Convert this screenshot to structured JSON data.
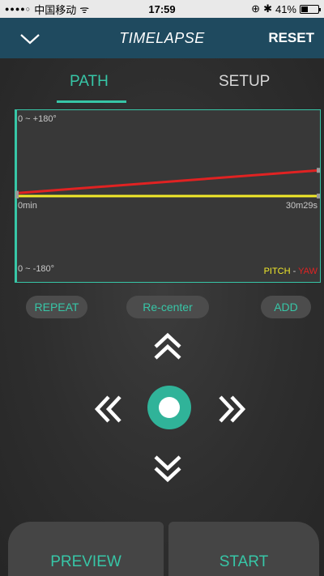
{
  "status_bar": {
    "signal": "●●●●○",
    "carrier": "中国移动",
    "wifi": "ᯤ",
    "time": "17:59",
    "lock": "⊕",
    "bluetooth": "✱",
    "battery": "41%",
    "battery_level": 0.41
  },
  "navbar": {
    "title": "TIMELAPSE",
    "reset_label": "RESET",
    "back_icon": "chevron-down-icon"
  },
  "tabs": [
    {
      "label": "PATH",
      "active": true
    },
    {
      "label": "SETUP",
      "active": false
    }
  ],
  "graph": {
    "top_label": "0 ~ +180°",
    "bottom_label": "0 ~ -180°",
    "start_label": "0min",
    "end_label": "30m29s",
    "legend_pitch": "PITCH",
    "legend_sep": "-",
    "legend_yaw": "YAW",
    "colors": {
      "pitch": "#f1e92a",
      "yaw": "#e02222",
      "accent": "#37c6a7"
    }
  },
  "chart_data": {
    "type": "line",
    "series": [
      {
        "name": "PITCH",
        "values": [
          0,
          0
        ]
      },
      {
        "name": "YAW",
        "values": [
          6,
          55
        ]
      }
    ]
  },
  "actions": {
    "repeat_label": "REPEAT",
    "recenter_label": "Re-center",
    "add_label": "ADD"
  },
  "controls": {
    "up_icon": "chevron-double-up-icon",
    "down_icon": "chevron-double-down-icon",
    "left_icon": "chevron-double-left-icon",
    "right_icon": "chevron-double-right-icon",
    "center_icon": "center-record-icon"
  },
  "bottom": {
    "preview_label": "PREVIEW",
    "start_label": "START"
  }
}
